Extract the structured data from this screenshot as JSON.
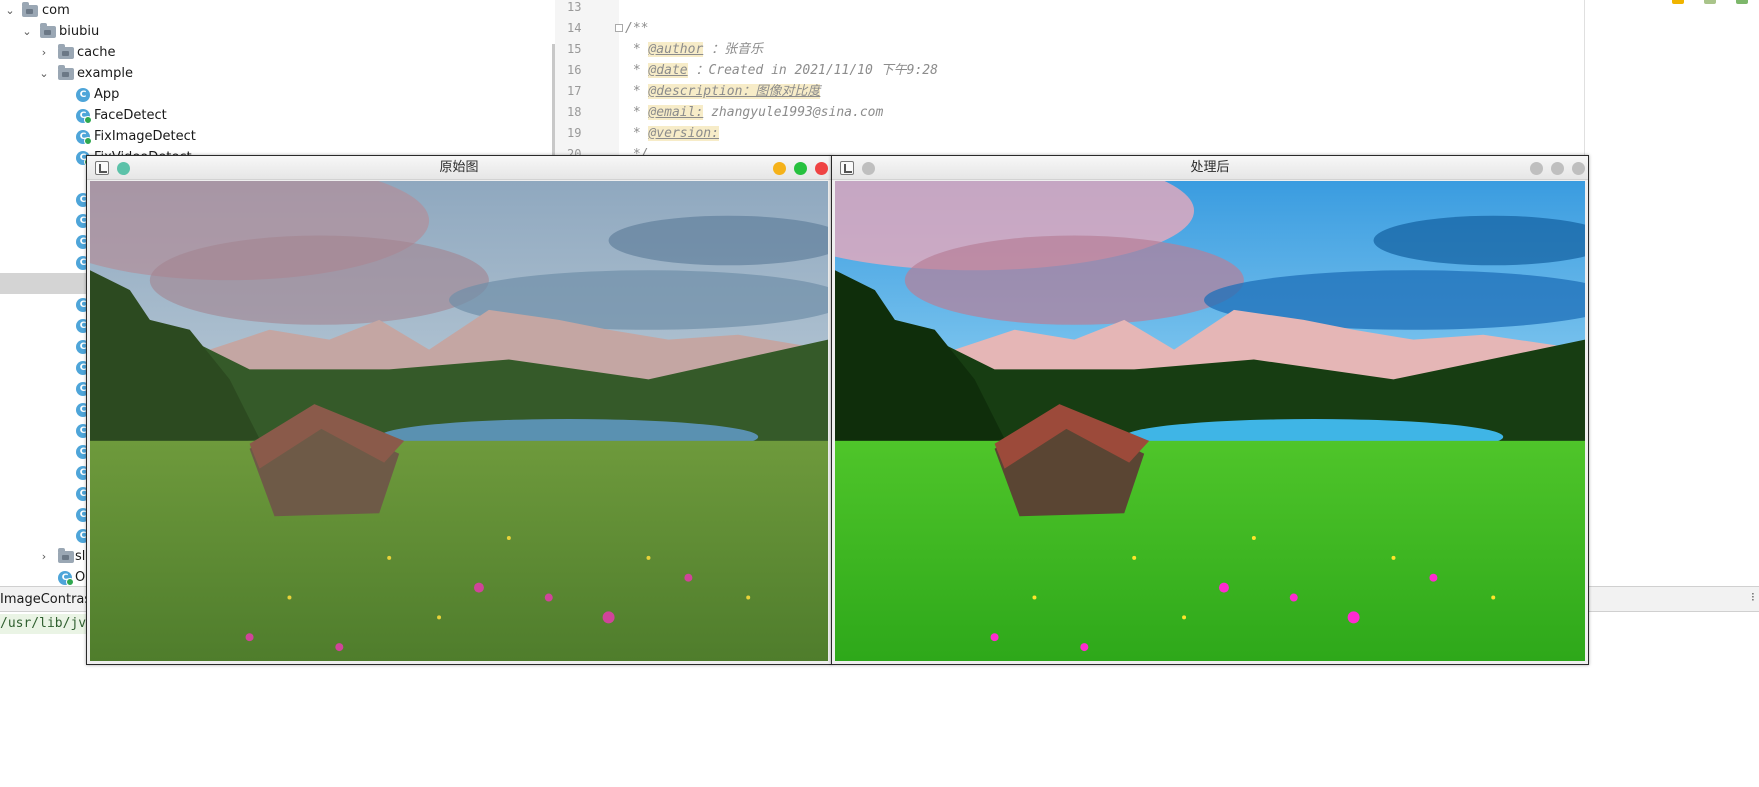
{
  "tree": {
    "items": [
      {
        "label": "com",
        "kind": "folder",
        "indent": 0,
        "expanded": true
      },
      {
        "label": "biubiu",
        "kind": "folder",
        "indent": 1,
        "expanded": true
      },
      {
        "label": "cache",
        "kind": "folder",
        "indent": 2,
        "expanded": false
      },
      {
        "label": "example",
        "kind": "folder",
        "indent": 2,
        "expanded": true
      },
      {
        "label": "App",
        "kind": "class",
        "indent": 3
      },
      {
        "label": "FaceDetect",
        "kind": "class-run",
        "indent": 3
      },
      {
        "label": "FixImageDetect",
        "kind": "class-run",
        "indent": 3
      }
    ],
    "partial_item": "FixVideoDetect",
    "lower_folder_label": "sl",
    "lower_class_label": "O"
  },
  "editor": {
    "lines": [
      {
        "num": "13",
        "text": ""
      },
      {
        "num": "14",
        "text": "/**"
      },
      {
        "num": "15",
        "prefix": " * ",
        "tag": "@author",
        "rest": " ：张音乐"
      },
      {
        "num": "16",
        "prefix": " * ",
        "tag": "@date",
        "rest": " ：Created in 2021/11/10 下午9:28"
      },
      {
        "num": "17",
        "prefix": " * ",
        "tag": "@description：图像对比度",
        "rest": ""
      },
      {
        "num": "18",
        "prefix": " * ",
        "tag": "@email:",
        "rest": " zhangyule1993@sina.com"
      },
      {
        "num": "19",
        "prefix": " * ",
        "tag": "@version:",
        "rest": ""
      },
      {
        "num": "20",
        "text": " */"
      }
    ]
  },
  "run": {
    "tab_label": "ImageContrast",
    "path": "/usr/lib/jvm"
  },
  "windows": {
    "original": {
      "title": "原始图"
    },
    "processed": {
      "title": "处理后"
    }
  },
  "colors": {
    "btn_yellow": "#f5b21a",
    "btn_green": "#27c13f",
    "btn_red": "#ef4343",
    "btn_teal": "#5cc2a9",
    "btn_gray": "#bfbfbf"
  }
}
